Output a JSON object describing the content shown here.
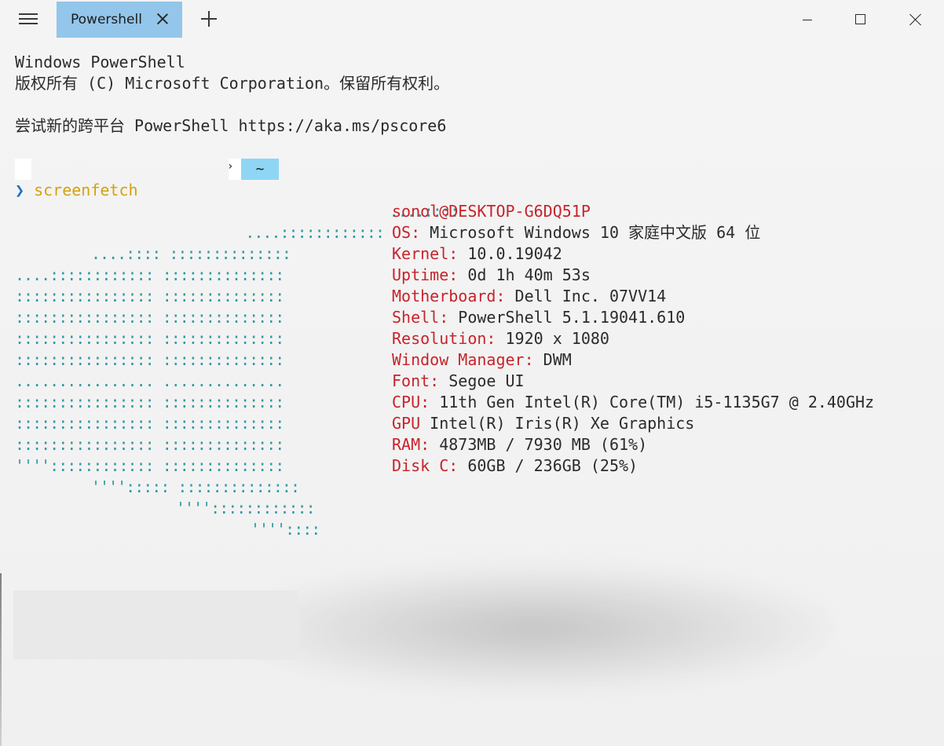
{
  "tab": {
    "title": "Powershell"
  },
  "icons": {
    "menu": "hamburger-icon",
    "tab_close": "close-icon",
    "new_tab": "plus-icon",
    "minimize": "minimize-icon",
    "maximize": "maximize-icon",
    "close": "close-icon"
  },
  "header_lines": [
    "Windows PowerShell",
    "版权所有 (C) Microsoft Corporation。保留所有权利。",
    "",
    "尝试新的跨平台 PowerShell https://aka.ms/pscore6"
  ],
  "prompt": {
    "segment_glyph": "›",
    "tilde": "~",
    "chevron": "❯",
    "command": "screenfetch"
  },
  "logo_lines": [
    "                ....::::",
    "        ....::::::::::::",
    "....:::: ::::::::::::::",
    "....:::::::::::: ::::::::::::::",
    ":::::::::::::::: ::::::::::::::",
    ":::::::::::::::: ::::::::::::::",
    ":::::::::::::::: ::::::::::::::",
    ":::::::::::::::: ::::::::::::::",
    "................ ..............",
    ":::::::::::::::: ::::::::::::::",
    ":::::::::::::::: ::::::::::::::",
    ":::::::::::::::: ::::::::::::::",
    "'''':::::::::::: ::::::::::::::",
    "''''::::: ::::::::::::::",
    "''''::::::::::::",
    "''''::::"
  ],
  "info": {
    "user_host": "sonol@DESKTOP-G6DQ51P",
    "rows": [
      {
        "key": "OS:",
        "value": " Microsoft Windows 10 家庭中文版 64 位"
      },
      {
        "key": "Kernel:",
        "value": " 10.0.19042"
      },
      {
        "key": "Uptime:",
        "value": " 0d 1h 40m 53s"
      },
      {
        "key": "Motherboard:",
        "value": " Dell Inc. 07VV14"
      },
      {
        "key": "Shell:",
        "value": " PowerShell 5.1.19041.610"
      },
      {
        "key": "Resolution:",
        "value": " 1920 x 1080"
      },
      {
        "key": "Window Manager:",
        "value": " DWM"
      },
      {
        "key": "Font:",
        "value": " Segoe UI"
      },
      {
        "key": "CPU:",
        "value": " 11th Gen Intel(R) Core(TM) i5-1135G7 @ 2.40GHz"
      },
      {
        "key": "GPU",
        "value": " Intel(R) Iris(R) Xe Graphics"
      },
      {
        "key": "RAM:",
        "value": " 4873MB / 7930 MB (61%)"
      },
      {
        "key": "Disk C:",
        "value": " 60GB / 236GB (25%)"
      }
    ]
  },
  "colors": {
    "tab_bg": "#93c6ea",
    "prompt_tilde_bg": "#8fd6f5",
    "info_key": "#c7232a",
    "logo": "#2e9aa6",
    "command": "#d4a20a",
    "chevron": "#1e6fc5"
  }
}
